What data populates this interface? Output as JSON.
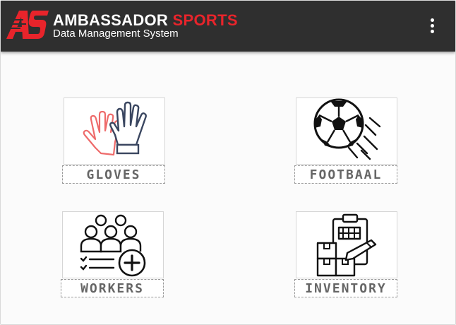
{
  "header": {
    "brand_primary": "AMBASSADOR",
    "brand_accent": "SPORTS",
    "subtitle": "Data Management System",
    "logo_text": "AS",
    "menu_icon": "more-vertical-icon"
  },
  "tiles": [
    {
      "label": "GLOVES",
      "icon": "gloves-icon"
    },
    {
      "label": "FOOTBAAL",
      "icon": "soccer-ball-icon"
    },
    {
      "label": "WORKERS",
      "icon": "workers-add-icon"
    },
    {
      "label": "INVENTORY",
      "icon": "inventory-clipboard-icon"
    }
  ],
  "colors": {
    "topbar": "#2f2f2f",
    "accent_red": "#e8242b",
    "glove_pink": "#ee6b6b",
    "glove_navy": "#3a4660"
  }
}
